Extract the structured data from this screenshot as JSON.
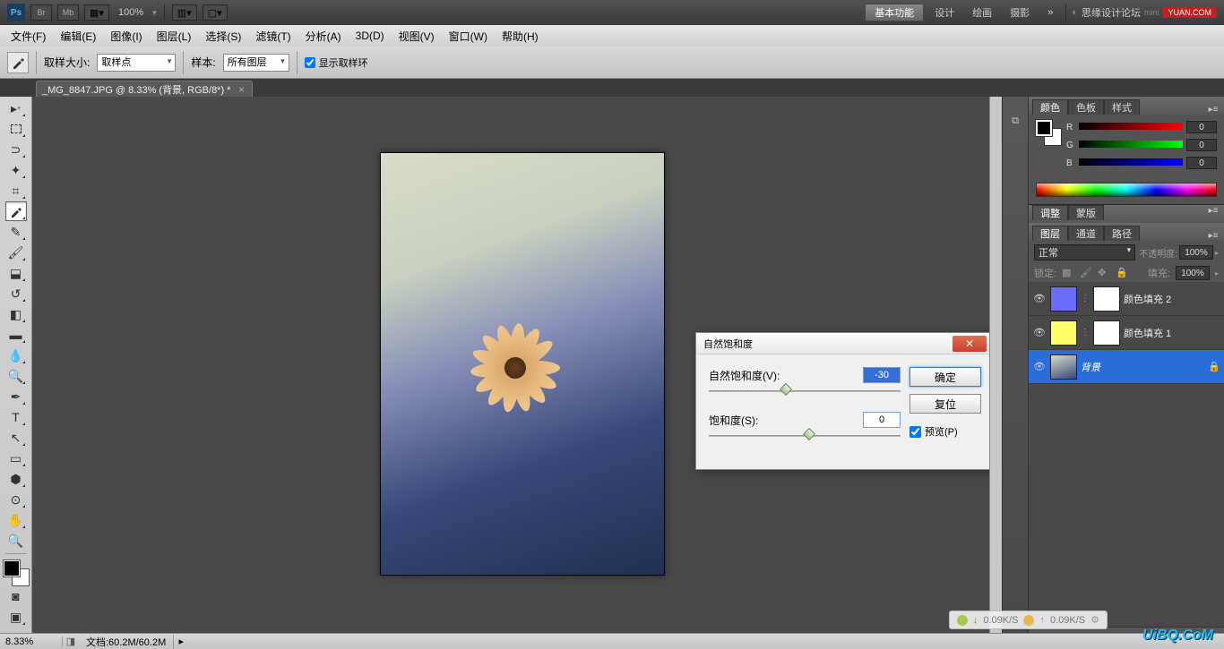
{
  "topbar": {
    "logo": "Ps",
    "br": "Br",
    "mb": "Mb",
    "zoom": "100%",
    "workspace_active": "基本功能",
    "workspaces": [
      "设计",
      "绘画",
      "摄影"
    ],
    "more": "»",
    "search_text": "思缘设计论坛",
    "yuan": "YUAN.COM"
  },
  "menus": [
    "文件(F)",
    "编辑(E)",
    "图像(I)",
    "图层(L)",
    "选择(S)",
    "滤镜(T)",
    "分析(A)",
    "3D(D)",
    "视图(V)",
    "窗口(W)",
    "帮助(H)"
  ],
  "optbar": {
    "sample_size_label": "取样大小:",
    "sample_size_value": "取样点",
    "sample_label": "样本:",
    "sample_value": "所有图层",
    "show_ring": "显示取样环"
  },
  "doctab": {
    "title": "_MG_8847.JPG @ 8.33% (背景, RGB/8*) *"
  },
  "dialog": {
    "title": "自然饱和度",
    "vibrance_label": "自然饱和度(V):",
    "vibrance_value": "-30",
    "saturation_label": "饱和度(S):",
    "saturation_value": "0",
    "ok": "确定",
    "reset": "复位",
    "preview": "预览(P)"
  },
  "panels": {
    "color_tabs": [
      "颜色",
      "色板",
      "样式"
    ],
    "rgb": {
      "r": "0",
      "g": "0",
      "b": "0",
      "r_label": "R",
      "g_label": "G",
      "b_label": "B"
    },
    "adj_tabs": [
      "调整",
      "蒙版"
    ],
    "layers_tabs": [
      "图层",
      "通道",
      "路径"
    ],
    "blend_mode": "正常",
    "opacity_label": "不透明度:",
    "opacity": "100%",
    "lock_label": "锁定:",
    "fill_label": "填充:",
    "fill": "100%",
    "layers": [
      {
        "name": "颜色填充 2",
        "thumb_color": "#6b6bff"
      },
      {
        "name": "颜色填充 1",
        "thumb_color": "#ffff66"
      },
      {
        "name": "背景",
        "locked": true
      }
    ]
  },
  "statusbar": {
    "zoom": "8.33%",
    "doc": "文档:60.2M/60.2M"
  },
  "net": {
    "down": "0.09K/S",
    "up": "0.09K/S"
  },
  "watermark": "UiBQ.CoM"
}
